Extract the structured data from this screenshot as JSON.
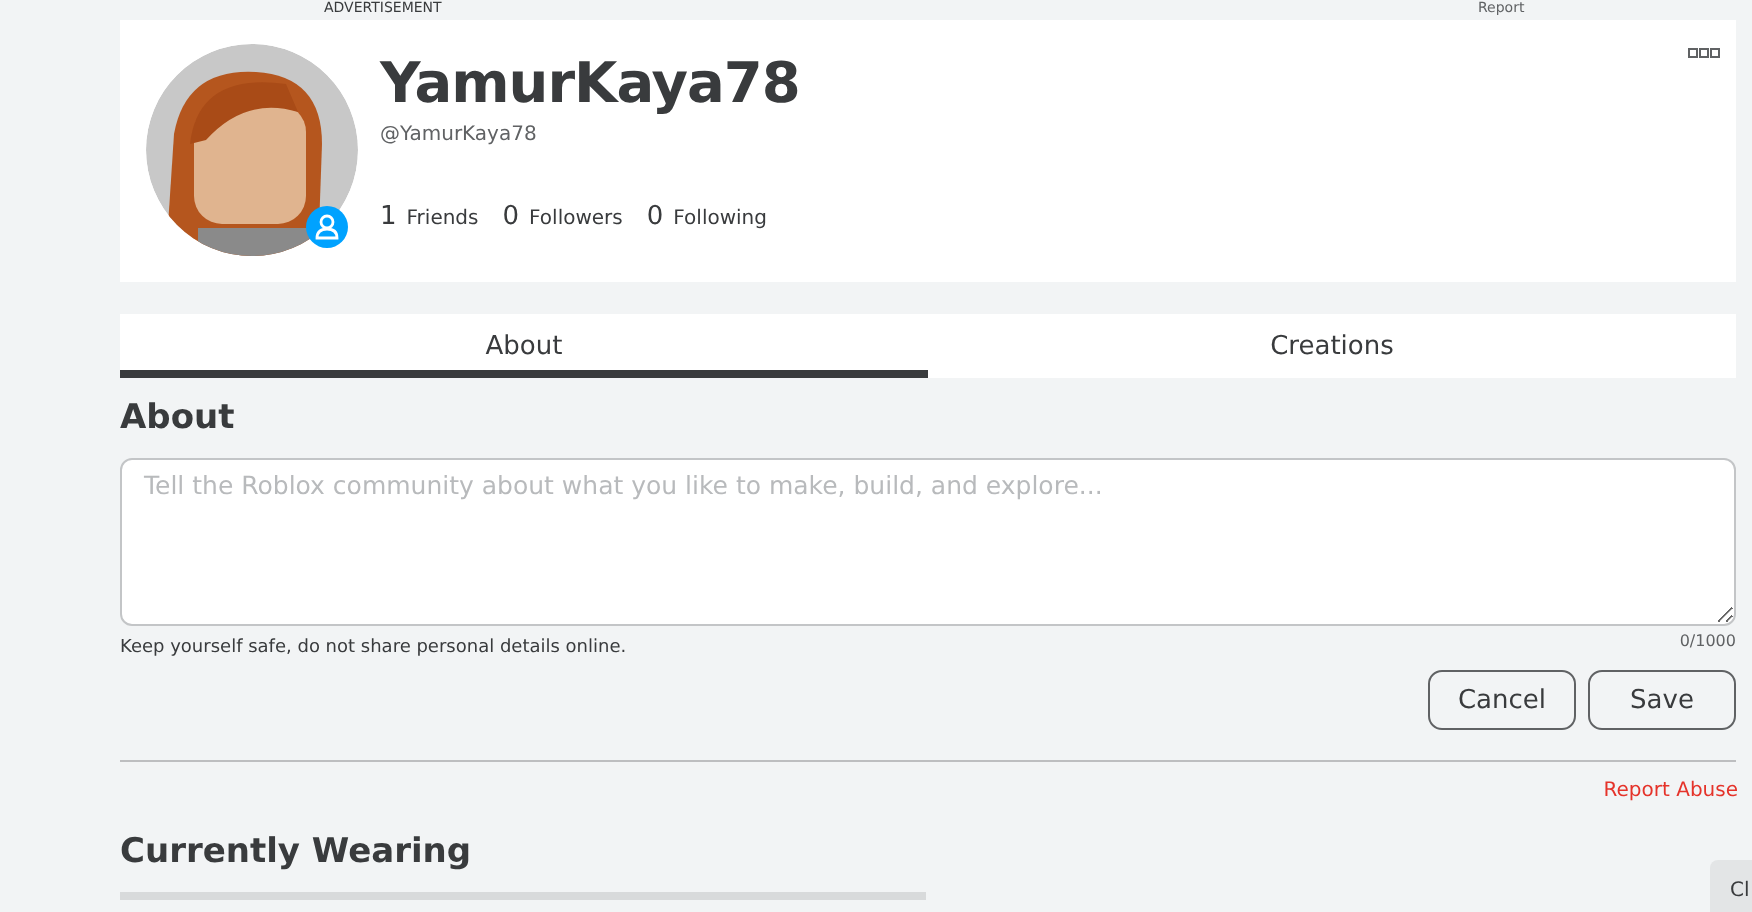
{
  "ad_bar": {
    "label": "ADVERTISEMENT",
    "report": "Report"
  },
  "profile": {
    "display_name": "YamurKaya78",
    "username": "@YamurKaya78",
    "stats": [
      {
        "count": "1",
        "label": "Friends"
      },
      {
        "count": "0",
        "label": "Followers"
      },
      {
        "count": "0",
        "label": "Following"
      }
    ]
  },
  "tabs": [
    {
      "label": "About",
      "selected": true
    },
    {
      "label": "Creations",
      "selected": false
    }
  ],
  "about": {
    "heading": "About",
    "placeholder": "Tell the Roblox community about what you like to make, build, and explore...",
    "hint": "Keep yourself safe, do not share personal details online.",
    "counter": "0/1000",
    "buttons": [
      "Cancel",
      "Save"
    ],
    "report_abuse": "Report Abuse"
  },
  "currently_wearing": {
    "heading": "Currently Wearing"
  },
  "chat_tab": {
    "label": "Cl"
  }
}
